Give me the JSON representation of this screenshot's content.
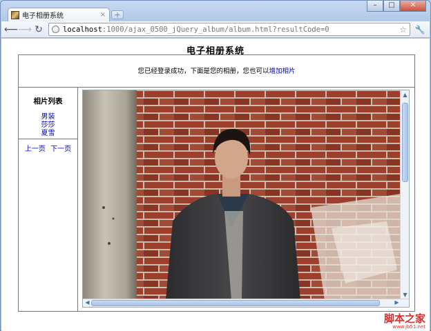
{
  "browser": {
    "tab_title": "电子相册系统",
    "tab_close": "×",
    "new_tab": "+",
    "url_host": "localhost",
    "url_rest": ":1000/ajax_0500_jQuery_album/album.html?resultCode=0",
    "window_controls": [
      "minimize-icon",
      "maximize-icon",
      "close-icon"
    ]
  },
  "page": {
    "title": "电子相册系统",
    "message_prefix": "您已经登录成功，下面是您的相册，您也可以",
    "add_album_link": "增加相片"
  },
  "sidebar": {
    "title": "相片列表",
    "albums": [
      "男装",
      "莎莎",
      "夏雪"
    ],
    "prev": "上一页",
    "next": "下一页"
  },
  "watermark": {
    "line1": "脚本之家",
    "line2": "www.jb51.net"
  },
  "colors": {
    "link": "#0000cc",
    "brick": "#8f3f2b",
    "watermark": "#d72f2f"
  }
}
